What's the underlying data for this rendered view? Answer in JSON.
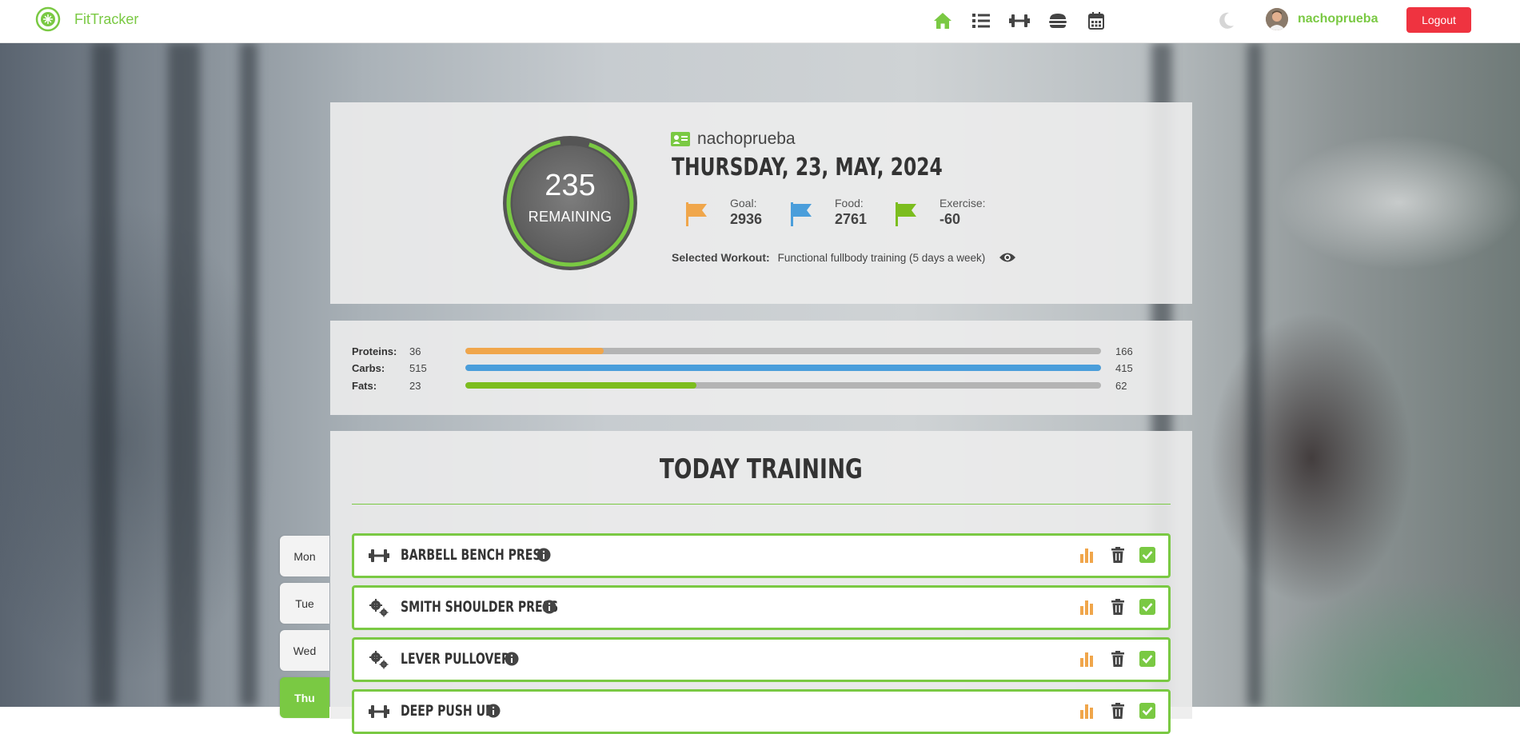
{
  "app": {
    "name": "FitTracker"
  },
  "nav": {
    "icons": [
      "home-icon",
      "list-icon",
      "dumbbell-icon",
      "burger-icon",
      "calendar-icon"
    ],
    "active": "home-icon",
    "username": "nachoprueba",
    "logout_label": "Logout"
  },
  "summary": {
    "remaining_value": "235",
    "remaining_label": "REMAINING",
    "username": "nachoprueba",
    "date": "THURSDAY, 23, MAY, 2024",
    "goal_label": "Goal:",
    "goal_value": "2936",
    "food_label": "Food:",
    "food_value": "2761",
    "exercise_label": "Exercise:",
    "exercise_value": "-60",
    "workout_label": "Selected Workout:",
    "workout_value": "Functional fullbody training (5 days a week)"
  },
  "macros": {
    "proteins": {
      "label": "Proteins:",
      "current": "36",
      "target": "166",
      "fill": 0.217,
      "color": "#f0a64b"
    },
    "carbs": {
      "label": "Carbs:",
      "current": "515",
      "target": "415",
      "fill": 1.0,
      "color": "#4a9edb"
    },
    "fats": {
      "label": "Fats:",
      "current": "23",
      "target": "62",
      "fill": 0.363,
      "color": "#7cbd1e"
    }
  },
  "training": {
    "title": "TODAY TRAINING",
    "exercises": [
      {
        "name": "BARBELL BENCH PRESS",
        "icon": "dumbbell-icon"
      },
      {
        "name": "SMITH SHOULDER PRESS",
        "icon": "gears-icon"
      },
      {
        "name": "LEVER PULLOVER",
        "icon": "gears-icon"
      },
      {
        "name": "DEEP PUSH UP",
        "icon": "dumbbell-icon"
      }
    ]
  },
  "days": {
    "mon": "Mon",
    "tue": "Tue",
    "wed": "Wed",
    "thu": "Thu",
    "active": "Thu"
  },
  "colors": {
    "accent": "#7ac943",
    "logout": "#ef3340",
    "goal_flag": "#f0a64b",
    "food_flag": "#4a9edb",
    "exercise_flag": "#7cbd1e"
  }
}
